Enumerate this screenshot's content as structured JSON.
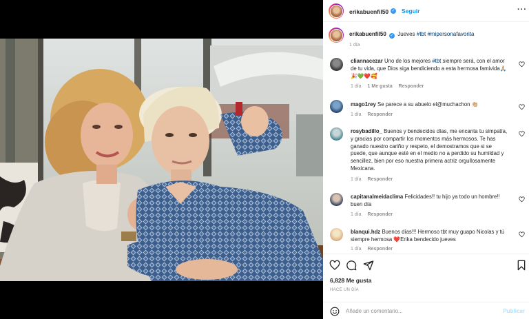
{
  "header": {
    "username": "erikabuenfil50",
    "follow_label": "Seguir",
    "more_label": "···"
  },
  "caption": {
    "username": "erikabuenfil50",
    "text": "Jueves",
    "hashtags": [
      "#tbt",
      "#mipersonafavorita"
    ],
    "time": "1 día"
  },
  "comments": [
    {
      "username": "cliannacezar",
      "pre": "Uno de los mejores ",
      "tag": "#tbt",
      "post": " siempre será, con el amor de tu vida, que Dios siga bendiciendo a esta hermosa famivida🙏🏼🎉💚❤️🥰",
      "time": "1 día",
      "likes": "1 Me gusta",
      "reply": "Responder",
      "avatar": "dark"
    },
    {
      "username": "mago1rey",
      "pre": "Se parece a su abuelo el@muchachon 👏🏼",
      "tag": "",
      "post": "",
      "time": "1 día",
      "likes": "",
      "reply": "Responder",
      "avatar": "blue"
    },
    {
      "username": "rosybadillo_",
      "pre": "Buenos y bendecidos días, me encanta tu simpatía, y gracias por compartir los momentos más hermosos. Te has ganado nuestro cariño y respeto, el demostramos que si se puede, que aunque esté en el medio no a perdido su humildad y sencillez, bien por eso nuestra primera actriz orgullosamente Mexicana.",
      "tag": "",
      "post": "",
      "time": "1 día",
      "likes": "",
      "reply": "Responder",
      "avatar": "teal"
    },
    {
      "username": "capitanalmeidaclima",
      "pre": "Felicidades!! tu hijo ya todo un hombre!! buen día",
      "tag": "",
      "post": "",
      "time": "1 día",
      "likes": "",
      "reply": "Responder",
      "avatar": "navy"
    },
    {
      "username": "blanqui.hdz",
      "pre": "Buenos días!!! Hermoso tbt muy guapo Nicolas y tú siempre hermosa ❤️Erika bendecido jueves",
      "tag": "",
      "post": "",
      "time": "1 día",
      "likes": "",
      "reply": "Responder",
      "avatar": "peach"
    }
  ],
  "actions": {
    "likes_count": "6,828 Me gusta",
    "date_label": "HACE UN DÍA"
  },
  "composer": {
    "placeholder": "Añade un comentario...",
    "post_label": "Publicar"
  },
  "colors": {
    "link_blue": "#0095f6",
    "hashtag_blue": "#00376b",
    "muted_gray": "#8e8e8e",
    "border": "#efefef",
    "verified": "#3897f0"
  }
}
